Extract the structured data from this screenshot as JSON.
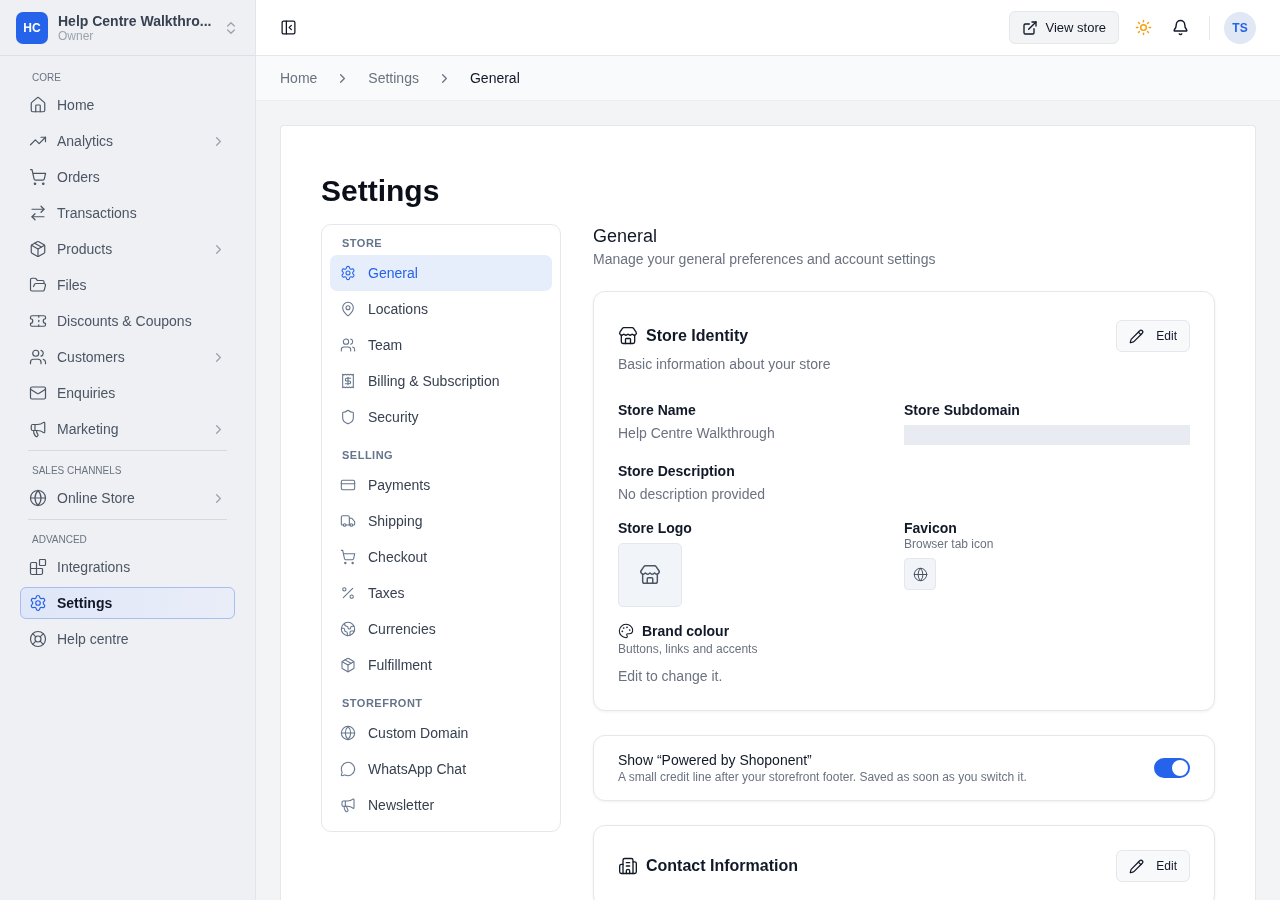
{
  "workspace": {
    "initials": "HC",
    "name": "Help Centre Walkthro...",
    "role": "Owner"
  },
  "sidebar": {
    "sections": [
      {
        "title": "CORE",
        "items": [
          {
            "label": "Home",
            "expandable": false,
            "selected": false
          },
          {
            "label": "Analytics",
            "expandable": true,
            "selected": false
          },
          {
            "label": "Orders",
            "expandable": false,
            "selected": false
          },
          {
            "label": "Transactions",
            "expandable": false,
            "selected": false
          },
          {
            "label": "Products",
            "expandable": true,
            "selected": false
          },
          {
            "label": "Files",
            "expandable": false,
            "selected": false
          },
          {
            "label": "Discounts & Coupons",
            "expandable": false,
            "selected": false
          },
          {
            "label": "Customers",
            "expandable": true,
            "selected": false
          },
          {
            "label": "Enquiries",
            "expandable": false,
            "selected": false
          },
          {
            "label": "Marketing",
            "expandable": true,
            "selected": false
          }
        ]
      },
      {
        "title": "SALES CHANNELS",
        "items": [
          {
            "label": "Online Store",
            "expandable": true,
            "selected": false
          }
        ]
      },
      {
        "title": "ADVANCED",
        "items": [
          {
            "label": "Integrations",
            "expandable": false,
            "selected": false
          },
          {
            "label": "Settings",
            "expandable": false,
            "selected": true
          },
          {
            "label": "Help centre",
            "expandable": false,
            "selected": false
          }
        ]
      }
    ]
  },
  "topbar": {
    "view_store": "View store",
    "avatar": "TS"
  },
  "breadcrumb": [
    "Home",
    "Settings",
    "General"
  ],
  "page_title": "Settings",
  "settings_nav": [
    {
      "title": "STORE",
      "items": [
        {
          "label": "General",
          "selected": true
        },
        {
          "label": "Locations",
          "selected": false
        },
        {
          "label": "Team",
          "selected": false
        },
        {
          "label": "Billing & Subscription",
          "selected": false
        },
        {
          "label": "Security",
          "selected": false
        }
      ]
    },
    {
      "title": "SELLING",
      "items": [
        {
          "label": "Payments",
          "selected": false
        },
        {
          "label": "Shipping",
          "selected": false
        },
        {
          "label": "Checkout",
          "selected": false
        },
        {
          "label": "Taxes",
          "selected": false
        },
        {
          "label": "Currencies",
          "selected": false
        },
        {
          "label": "Fulfillment",
          "selected": false
        }
      ]
    },
    {
      "title": "STOREFRONT",
      "items": [
        {
          "label": "Custom Domain",
          "selected": false
        },
        {
          "label": "WhatsApp Chat",
          "selected": false
        },
        {
          "label": "Newsletter",
          "selected": false
        }
      ]
    }
  ],
  "section": {
    "title": "General",
    "subtitle": "Manage your general preferences and account settings"
  },
  "identity_card": {
    "title": "Store Identity",
    "description": "Basic information about your store",
    "edit": "Edit",
    "fields": [
      {
        "kind": "text",
        "label": "Store Name",
        "value": "Help Centre Walkthrough"
      },
      {
        "kind": "skeleton",
        "label": "Store Subdomain"
      },
      {
        "kind": "text",
        "label": "Store Description",
        "value": "No description provided"
      },
      {
        "kind": "logo",
        "label": "Store Logo"
      },
      {
        "kind": "favicon",
        "label": "Favicon",
        "hint": "Browser tab icon"
      }
    ],
    "brand": {
      "label": "Brand colour",
      "hint": "Buttons, links and accents",
      "note": "Edit to change it."
    }
  },
  "powered_card": {
    "title": "Show “Powered by Shoponent”",
    "description": "A small credit line after your storefront footer. Saved as soon as you switch it.",
    "on": true
  },
  "contact_card": {
    "title": "Contact Information",
    "edit": "Edit"
  }
}
